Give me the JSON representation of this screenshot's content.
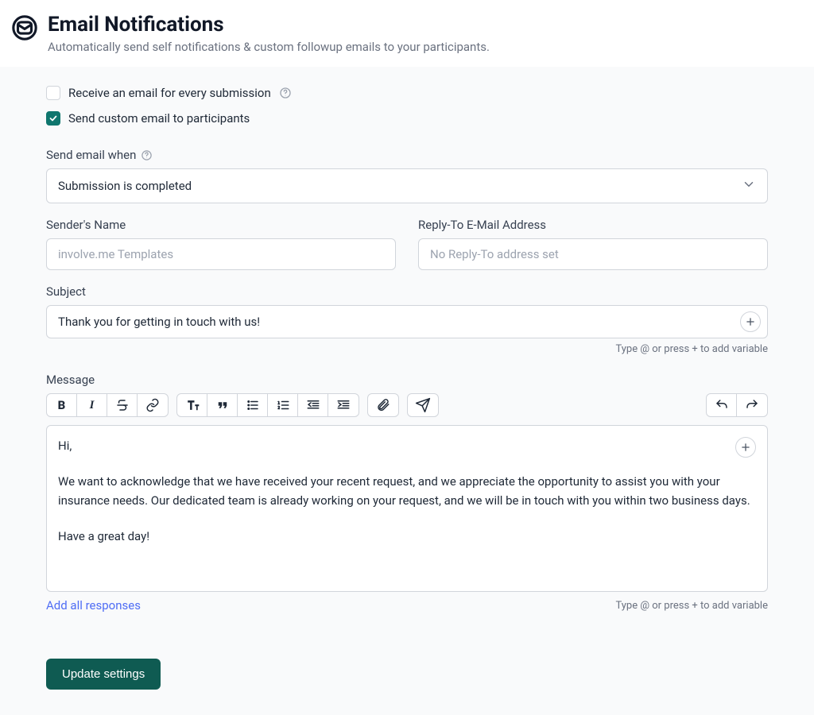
{
  "header": {
    "title": "Email Notifications",
    "subtitle": "Automatically send self notifications & custom followup emails to your participants."
  },
  "checks": {
    "receive_label": "Receive an email for every submission",
    "custom_label": "Send custom email to participants"
  },
  "trigger": {
    "label": "Send email when",
    "value": "Submission is completed"
  },
  "sender": {
    "label": "Sender's Name",
    "placeholder": "involve.me Templates"
  },
  "replyto": {
    "label": "Reply-To E-Mail Address",
    "placeholder": "No Reply-To address set"
  },
  "subject": {
    "label": "Subject",
    "value": "Thank you for getting in touch with us!",
    "hint": "Type @ or press + to add variable"
  },
  "message": {
    "label": "Message",
    "line1": "Hi,",
    "line2": "We want to acknowledge that we have received your recent request, and we appreciate the opportunity to assist you with your insurance needs. Our dedicated team is already working on your request, and we will be in touch with you within two business days.",
    "line3": "Have a great day!",
    "add_responses": "Add all responses",
    "hint": "Type @ or press + to add variable"
  },
  "actions": {
    "update": "Update settings"
  }
}
